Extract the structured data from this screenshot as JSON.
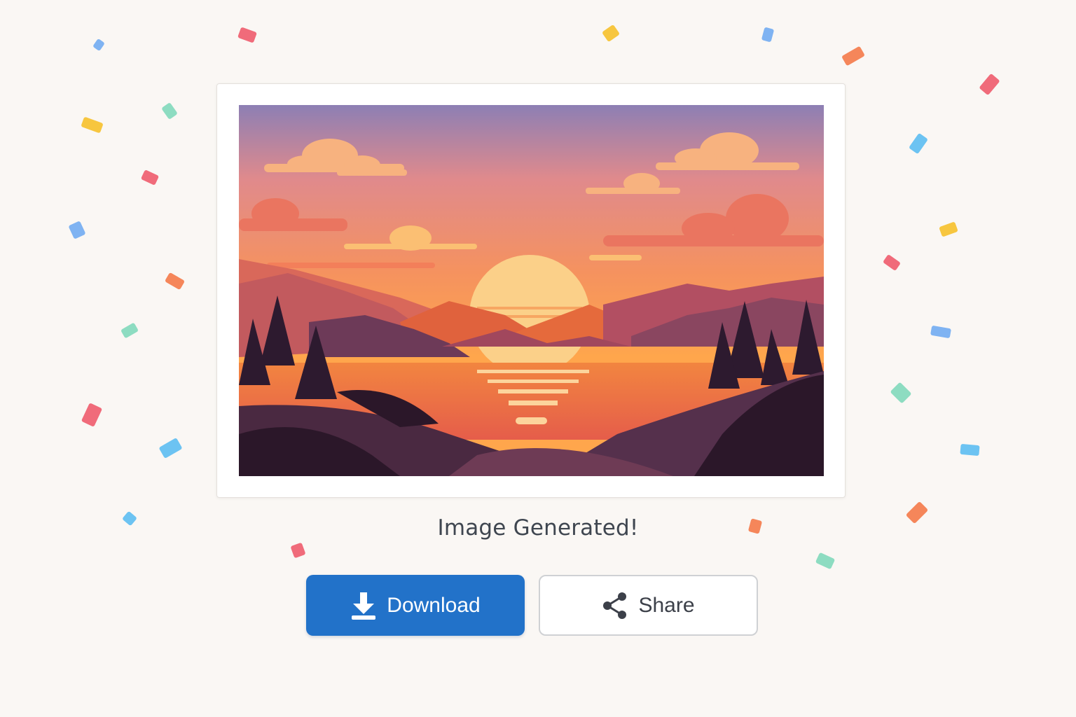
{
  "result": {
    "caption": "Image Generated!",
    "image_alt": "Sunset over a lake with mountains and pine trees"
  },
  "actions": {
    "download_label": "Download",
    "share_label": "Share"
  },
  "colors": {
    "primary": "#2272c9",
    "background": "#faf7f4",
    "confetti": [
      "#f06b7a",
      "#f7c63f",
      "#7fb3f2",
      "#f5865a",
      "#8ddcc1",
      "#6cc3f2"
    ]
  },
  "icons": {
    "download": "download-icon",
    "share": "share-icon"
  }
}
